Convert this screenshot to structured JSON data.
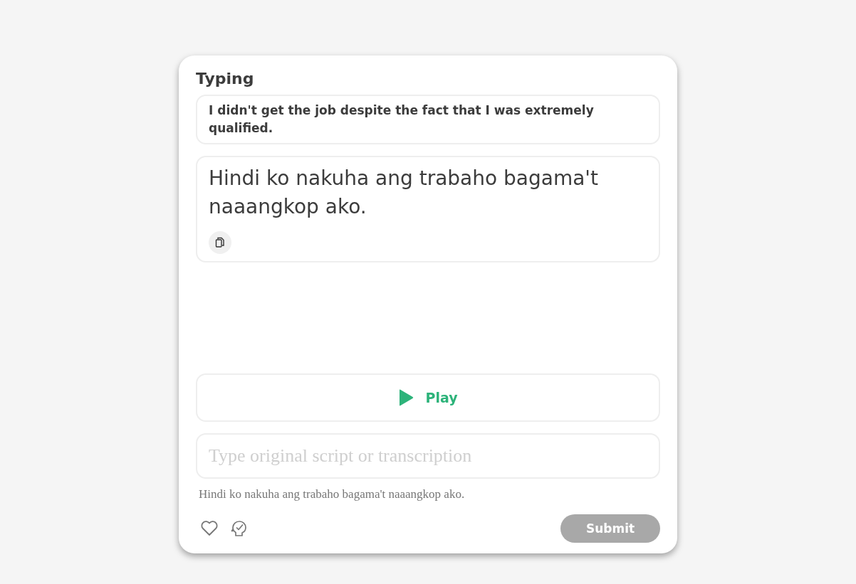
{
  "card": {
    "title": "Typing",
    "source": "I didn't get the job despite the fact that I was extremely qualified.",
    "translation": "Hindi ko nakuha ang trabaho bagama't naaangkop ako.",
    "play": {
      "label": "Play"
    },
    "answer": {
      "placeholder": "Type original script or transcription"
    },
    "hint": "Hindi ko nakuha ang trabaho bagama't naaangkop ako.",
    "submit": {
      "label": "Submit",
      "disabled": true
    }
  }
}
